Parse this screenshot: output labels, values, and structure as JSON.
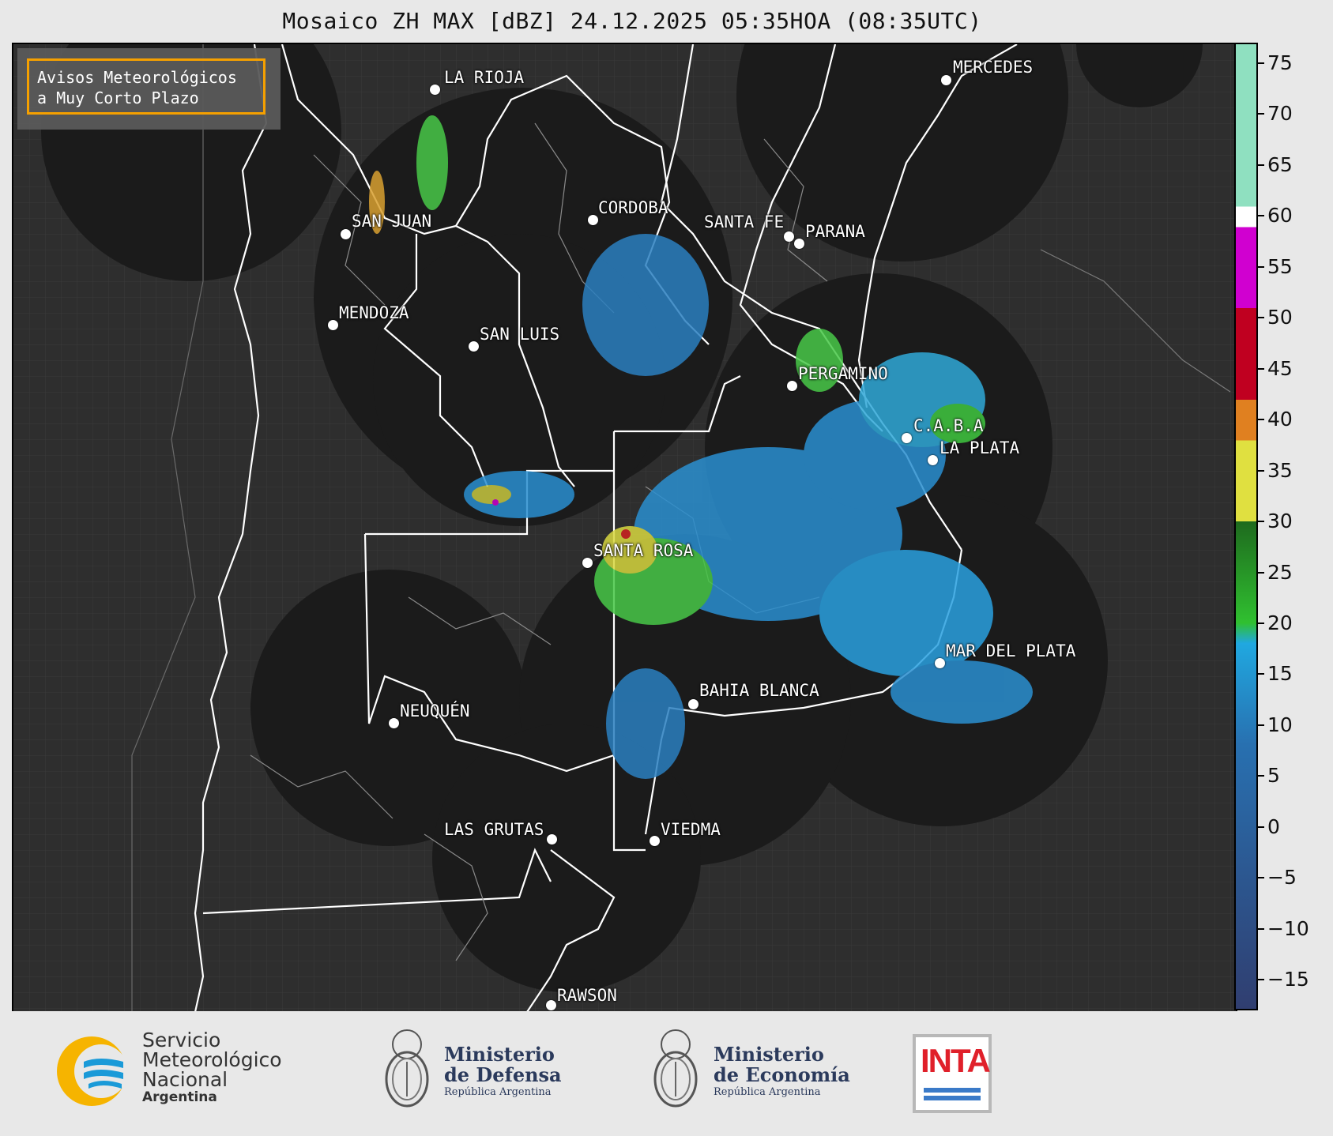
{
  "title": "Mosaico ZH MAX [dBZ] 24.12.2025 05:35HOA (08:35UTC)",
  "warning_box": {
    "line1": "Avisos Meteorológicos",
    "line2": "a Muy Corto Plazo",
    "border_color": "#f5a000"
  },
  "cities": [
    {
      "name": "LA RIOJA"
    },
    {
      "name": "MERCEDES"
    },
    {
      "name": "SAN JUAN"
    },
    {
      "name": "CORDOBA"
    },
    {
      "name": "SANTA FE"
    },
    {
      "name": "PARANA"
    },
    {
      "name": "MENDOZA"
    },
    {
      "name": "SAN LUIS"
    },
    {
      "name": "PERGAMINO"
    },
    {
      "name": "C.A.B.A"
    },
    {
      "name": "LA PLATA"
    },
    {
      "name": "SANTA ROSA"
    },
    {
      "name": "MAR DEL PLATA"
    },
    {
      "name": "BAHIA BLANCA"
    },
    {
      "name": "NEUQUÉN"
    },
    {
      "name": "LAS GRUTAS"
    },
    {
      "name": "VIEDMA"
    },
    {
      "name": "RAWSON"
    }
  ],
  "colorbar": {
    "ticks": [
      "75",
      "70",
      "65",
      "60",
      "55",
      "50",
      "45",
      "40",
      "35",
      "30",
      "25",
      "20",
      "15",
      "10",
      "5",
      "0",
      "−5",
      "−10",
      "−15"
    ],
    "range": [
      -18,
      77
    ],
    "colors": {
      "above60": "#8fe0c0",
      "magenta": "#d000d0",
      "red": "#c00020",
      "orange": "#e08020",
      "yellow": "#e0e040",
      "green": "#30c030",
      "cyan": "#20a8e0",
      "blue": "#2870b0",
      "navy": "#303e70"
    }
  },
  "footer": {
    "smn_line1": "Servicio",
    "smn_line2": "Meteorológico",
    "smn_line3": "Nacional",
    "smn_line4": "Argentina",
    "defensa_line1": "Ministerio",
    "defensa_line2": "de Defensa",
    "defensa_line3": "República Argentina",
    "economia_line1": "Ministerio",
    "economia_line2": "de Economía",
    "economia_line3": "República Argentina",
    "inta": "INTA"
  }
}
